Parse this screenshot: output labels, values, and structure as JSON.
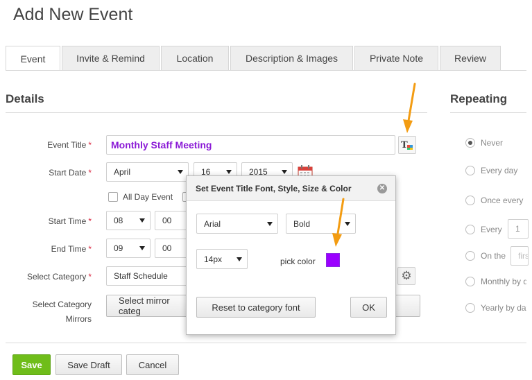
{
  "page": {
    "title": "Add New Event"
  },
  "tabs": [
    {
      "label": "Event"
    },
    {
      "label": "Invite & Remind"
    },
    {
      "label": "Location"
    },
    {
      "label": "Description & Images"
    },
    {
      "label": "Private Note"
    },
    {
      "label": "Review"
    }
  ],
  "details": {
    "heading": "Details",
    "event_title_label": "Event Title",
    "event_title_value": "Monthly Staff Meeting",
    "start_date_label": "Start Date",
    "start_month": "April",
    "start_day": "16",
    "start_year": "2015",
    "all_day_label": "All Day Event",
    "start_time_label": "Start Time",
    "start_hour": "08",
    "start_minute": "00",
    "end_time_label": "End Time",
    "end_hour": "09",
    "end_minute": "00",
    "category_label": "Select Category",
    "category_value": "Staff Schedule",
    "mirror_label_1": "Select Category",
    "mirror_label_2": "Mirrors",
    "mirror_button": "Select mirror categ",
    "required_mark": "*"
  },
  "repeating": {
    "heading": "Repeating",
    "options": [
      {
        "label": "Never",
        "selected": true
      },
      {
        "label": "Every day",
        "selected": false
      },
      {
        "label": "Once every",
        "selected": false
      },
      {
        "label": "Every",
        "selected": false
      },
      {
        "label": "On the",
        "selected": false
      },
      {
        "label": "Monthly by d",
        "selected": false
      },
      {
        "label": "Yearly by dat",
        "selected": false
      }
    ],
    "every_value": "1",
    "on_the_value": "firs"
  },
  "modal": {
    "title": "Set Event Title Font, Style, Size & Color",
    "close_glyph": "✕",
    "font_value": "Arial",
    "style_value": "Bold",
    "size_value": "14px",
    "pick_color_label": "pick color",
    "picked_color": "#9b00ff",
    "reset_button": "Reset to category font",
    "ok_button": "OK"
  },
  "footer": {
    "save_button": "Save",
    "save_draft_button": "Save Draft",
    "cancel_button": "Cancel"
  },
  "colors": {
    "accent_green": "#6fbd1a",
    "title_purple": "#8b1bd6",
    "arrow_orange": "#f39c12",
    "required_red": "#d9213b"
  }
}
